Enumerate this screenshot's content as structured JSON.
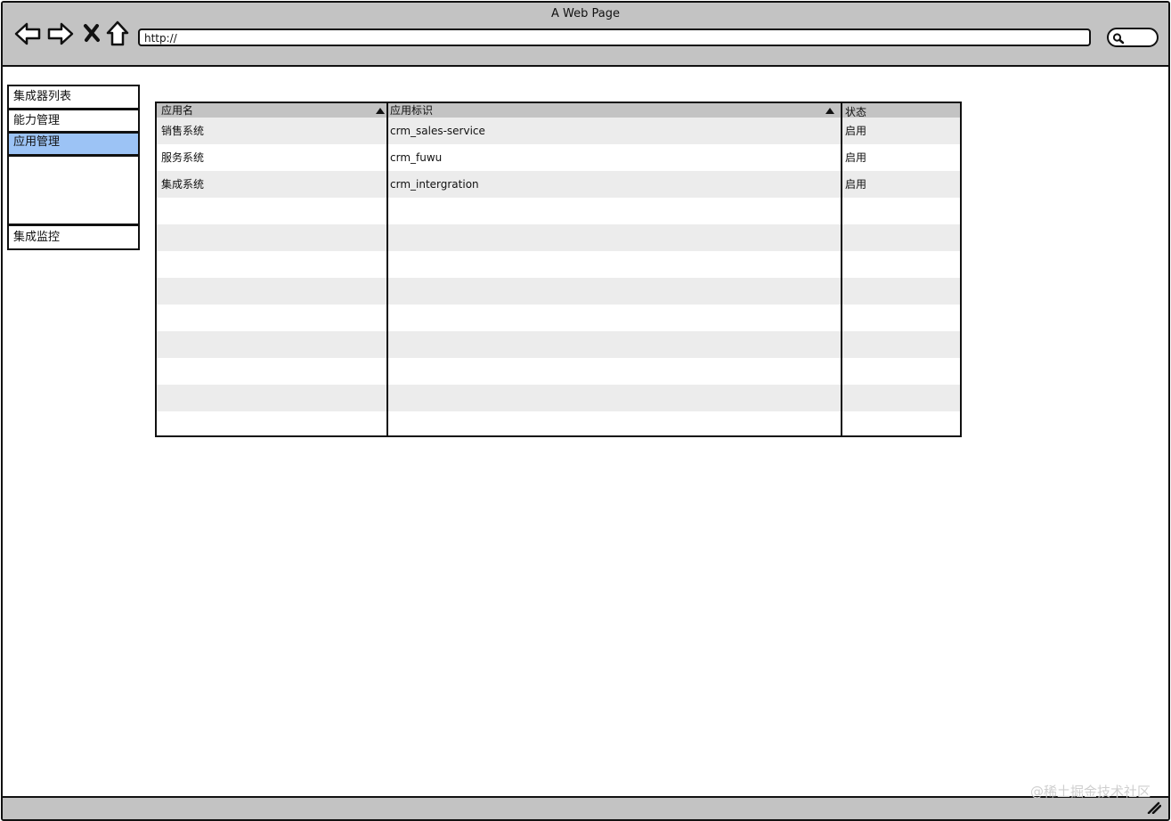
{
  "browser": {
    "title": "A Web Page",
    "url": "http://"
  },
  "sidebar": {
    "items": [
      {
        "label": "集成器列表",
        "active": false
      },
      {
        "label": "能力管理",
        "active": false
      },
      {
        "label": "应用管理",
        "active": true
      },
      {
        "label": "",
        "active": false
      },
      {
        "label": "集成监控",
        "active": false
      }
    ]
  },
  "table": {
    "columns": [
      {
        "label": "应用名",
        "sortable": true
      },
      {
        "label": "应用标识",
        "sortable": true
      },
      {
        "label": "状态",
        "sortable": false
      }
    ],
    "rows": [
      [
        "销售系统",
        "crm_sales-service",
        "启用"
      ],
      [
        "服务系统",
        "crm_fuwu",
        "启用"
      ],
      [
        "集成系统",
        "crm_intergration",
        "启用"
      ]
    ],
    "empty_row_count": 9
  },
  "watermark": "@稀土掘金技术社区",
  "colors": {
    "chrome": "#c3c3c3",
    "active_item": "#9cc3f5",
    "alt_row": "#ececec",
    "border": "#111111"
  }
}
